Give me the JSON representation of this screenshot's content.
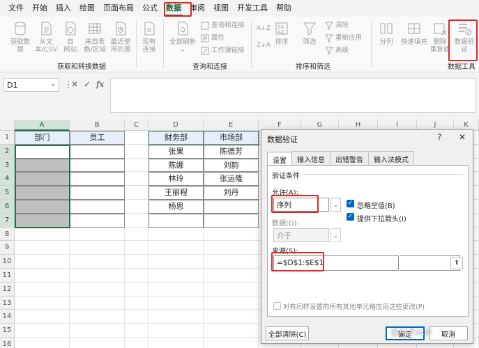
{
  "menu": [
    "文件",
    "开始",
    "插入",
    "绘图",
    "页面布局",
    "公式",
    "数据",
    "审阅",
    "视图",
    "开发工具",
    "帮助"
  ],
  "active_menu": "数据",
  "ribbon": {
    "get_data": {
      "get": [
        "获取数",
        "据"
      ],
      "text_csv": [
        "从文",
        "本/CSV"
      ],
      "web": [
        "自",
        "网站"
      ],
      "table": [
        "来自表",
        "格/区域"
      ],
      "recent": [
        "最近使",
        "用的源"
      ],
      "existing": [
        "现有",
        "连接"
      ]
    },
    "query": {
      "refresh_all": "全部刷新",
      "queries_connections": "查询和连接",
      "properties": "属性",
      "workbook_links": "工作簿链接"
    },
    "sort": {
      "az": "A↓Z",
      "za": "Z↓A",
      "sort": "排序",
      "filter": "筛选",
      "clear": "清除",
      "reapply": "重新应用",
      "advanced": "高级"
    },
    "tools": {
      "split": "分列",
      "flash_fill": "快速填充",
      "remove_dup": [
        "删除",
        "重复值"
      ],
      "validation": [
        "数据验",
        "证"
      ]
    },
    "groups": [
      "获取和转换数据",
      "查询和连接",
      "排序和筛选",
      "数据工具"
    ]
  },
  "formula_bar": {
    "name_box": "D1",
    "cancel": "✕",
    "enter": "✓",
    "fx": "fx"
  },
  "columns": [
    "A",
    "B",
    "C",
    "D",
    "E",
    "F",
    "G",
    "H",
    "I",
    "J",
    "K"
  ],
  "rows": [
    "1",
    "2",
    "3",
    "4",
    "5",
    "6",
    "7",
    "8",
    "9",
    "10",
    "11",
    "12",
    "13",
    "14",
    "15",
    "16"
  ],
  "sheet": {
    "a1": "部门",
    "b1": "员工",
    "d_col": [
      "财务部",
      "张果",
      "陈娜",
      "林玲",
      "王丽程",
      "杨思",
      ""
    ],
    "e_col": [
      "市场部",
      "陈德芳",
      "刘韵",
      "张运隆",
      "刘丹",
      "",
      ""
    ]
  },
  "dialog": {
    "title": "数据验证",
    "help": "?",
    "close": "✕",
    "tabs": [
      "设置",
      "输入信息",
      "出错警告",
      "输入法模式"
    ],
    "section": "验证条件",
    "allow_label": "允许(A):",
    "allow_value": "序列",
    "ignore_blank": "忽略空值(B)",
    "dropdown": "提供下拉箭头(I)",
    "data_label": "数据(D):",
    "data_value": "介于",
    "source_label": "来源(S):",
    "source_value": "=$D$1:$E$1",
    "apply_all": "对有同样设置的所有其他单元格应用这些更改(P)",
    "clear_all": "全部清除(C)",
    "ok": "确定",
    "cancel": "取消"
  },
  "watermark": "@AI Excel",
  "colors": {
    "accent": "#217346",
    "highlight": "#e0261f",
    "header_fill": "#e6eefc",
    "gray_fill": "#bfbfbf"
  }
}
